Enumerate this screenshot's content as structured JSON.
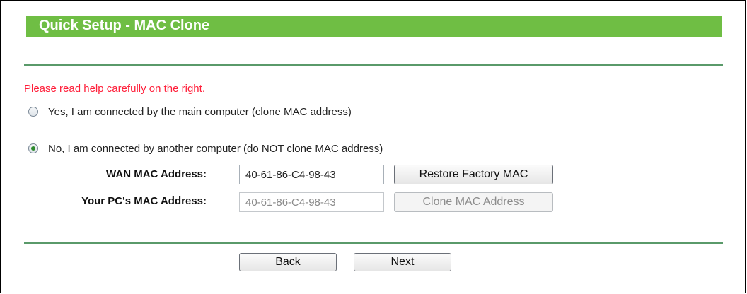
{
  "page": {
    "title": "Quick Setup - MAC Clone",
    "help_text": "Please read help carefully on the right."
  },
  "options": [
    {
      "label": "Yes, I am connected by the main computer (clone MAC address)",
      "selected": false
    },
    {
      "label": "No, I am connected by another computer (do NOT clone MAC address)",
      "selected": true
    }
  ],
  "fields": {
    "wan_mac": {
      "label": "WAN MAC Address:",
      "value": "40-61-86-C4-98-43"
    },
    "pc_mac": {
      "label": "Your PC's MAC Address:",
      "value": "40-61-86-C4-98-43"
    }
  },
  "buttons": {
    "restore_factory_mac": "Restore Factory MAC",
    "clone_mac_address": "Clone MAC Address",
    "back": "Back",
    "next": "Next"
  },
  "colors": {
    "title_bar": "#6fbe44",
    "help_text": "#ff1f3a",
    "divider": "#5a9a6a"
  }
}
